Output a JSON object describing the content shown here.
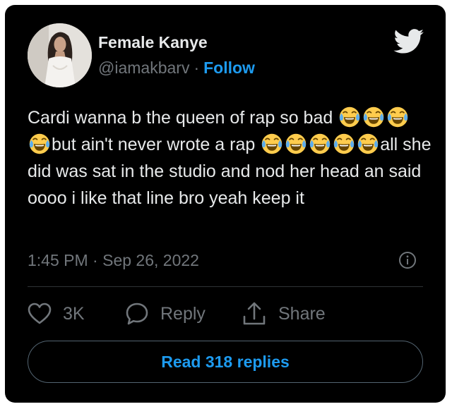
{
  "author": {
    "name": "Female Kanye",
    "handle": "@iamakbarv",
    "separator": "·",
    "follow_label": "Follow"
  },
  "tweet": {
    "segments": [
      {
        "type": "text",
        "value": "Cardi wanna b the queen of rap so bad "
      },
      {
        "type": "emoji",
        "value": "face-with-tears-of-joy"
      },
      {
        "type": "emoji",
        "value": "face-with-tears-of-joy"
      },
      {
        "type": "emoji",
        "value": "face-with-tears-of-joy"
      },
      {
        "type": "emoji",
        "value": "face-with-tears-of-joy"
      },
      {
        "type": "text",
        "value": "but ain't never wrote a rap "
      },
      {
        "type": "emoji",
        "value": "face-with-tears-of-joy"
      },
      {
        "type": "emoji",
        "value": "face-with-tears-of-joy"
      },
      {
        "type": "emoji",
        "value": "face-with-tears-of-joy"
      },
      {
        "type": "emoji",
        "value": "face-with-tears-of-joy"
      },
      {
        "type": "emoji",
        "value": "face-with-tears-of-joy"
      },
      {
        "type": "text",
        "value": "all she did was sat in the studio and nod her head an said oooo i like that line bro yeah keep it"
      }
    ]
  },
  "timestamp": {
    "time": "1:45 PM",
    "separator": "·",
    "date": "Sep 26, 2022"
  },
  "actions": {
    "like_count": "3K",
    "reply_label": "Reply",
    "share_label": "Share"
  },
  "read_replies_label": "Read 318 replies",
  "icons": {
    "brand": "twitter-bird-icon",
    "info": "info-icon",
    "like": "heart-icon",
    "reply": "speech-bubble-icon",
    "share": "share-upload-icon"
  },
  "colors": {
    "background": "#000000",
    "text": "#e7e9ea",
    "secondary": "#71767b",
    "accent": "#1d9bf0",
    "divider": "#2f3336"
  }
}
